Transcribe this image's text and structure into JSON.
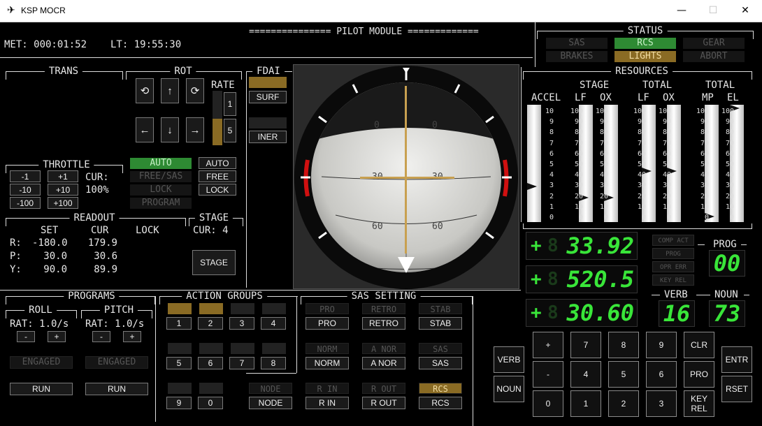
{
  "window": {
    "title": "KSP MOCR",
    "app_icon": "satellite-icon"
  },
  "header": {
    "met": "MET: 000:01:52",
    "lt": "LT: 19:55:30",
    "module_title": "=============== PILOT MODULE ============="
  },
  "status": {
    "title": "STATUS",
    "indicators": [
      {
        "label": "SAS",
        "state": "off"
      },
      {
        "label": "RCS",
        "state": "on"
      },
      {
        "label": "GEAR",
        "state": "off"
      },
      {
        "label": "BRAKES",
        "state": "off"
      },
      {
        "label": "LIGHTS",
        "state": "amber"
      },
      {
        "label": "ABORT",
        "state": "off"
      }
    ]
  },
  "trans": {
    "title": "TRANS"
  },
  "rot": {
    "title": "ROT",
    "rate_label": "RATE",
    "rate_values": [
      "1",
      "5"
    ],
    "buttons": [
      "⟲",
      "↑",
      "⟳",
      "←",
      "↓",
      "→"
    ]
  },
  "fdai": {
    "title": "FDAI",
    "modes": [
      "SURF",
      "INER"
    ]
  },
  "throttle": {
    "title": "THROTTLE",
    "buttons": [
      "-1",
      "+1",
      "-10",
      "+10",
      "-100",
      "+100"
    ],
    "cur_label": "CUR:",
    "cur_value": "100%"
  },
  "modes": {
    "indicators": [
      "AUTO",
      "FREE/SAS",
      "LOCK",
      "PROGRAM"
    ],
    "buttons": [
      "AUTO",
      "FREE",
      "LOCK"
    ]
  },
  "readout": {
    "title": "READOUT",
    "headers": [
      "SET",
      "CUR",
      "LOCK"
    ],
    "rows": [
      {
        "axis": "R:",
        "set": "-180.0",
        "cur": "179.9"
      },
      {
        "axis": "P:",
        "set": "30.0",
        "cur": "30.6"
      },
      {
        "axis": "Y:",
        "set": "90.0",
        "cur": "89.9"
      }
    ]
  },
  "stage": {
    "title": "STAGE",
    "cur": "CUR:  4",
    "button": "STAGE"
  },
  "resources": {
    "title": "RESOURCES",
    "group_labels": [
      "STAGE",
      "TOTAL",
      "TOTAL"
    ],
    "col_labels": [
      "ACCEL",
      "LF",
      "OX",
      "LF",
      "OX",
      "MP",
      "EL"
    ],
    "accel_scale": [
      "10",
      "9",
      "8",
      "7",
      "6",
      "5",
      "4",
      "3",
      "2",
      "1",
      "0"
    ],
    "pct_scale": [
      "100",
      "90",
      "80",
      "70",
      "60",
      "50",
      "40",
      "30",
      "20",
      "10",
      "0"
    ],
    "levels": {
      "accel": 0.3,
      "stage_lf": 0.2,
      "stage_ox": 0.2,
      "total_lf": 0.44,
      "total_ox": 0.44,
      "mp": 0.03,
      "el": 1.0
    }
  },
  "dsky": {
    "sign": "+",
    "r1": "33.92",
    "r2": "520.5",
    "r3": "30.60",
    "prog_label": "PROG",
    "prog": "00",
    "verb_label": "VERB",
    "verb": "16",
    "noun_label": "NOUN",
    "noun": "73",
    "lights": [
      "COMP ACT",
      "PROG",
      "OPR ERR",
      "KEY REL"
    ],
    "keys": [
      "+",
      "7",
      "8",
      "9",
      "CLR",
      "-",
      "4",
      "5",
      "6",
      "PRO",
      "0",
      "1",
      "2",
      "3",
      "KEY REL"
    ],
    "side_left": [
      "VERB",
      "NOUN"
    ],
    "side_right": [
      "ENTR",
      "RSET"
    ]
  },
  "programs": {
    "title": "PROGRAMS",
    "roll": {
      "title": "ROLL",
      "rat": "RAT: 1.0/s",
      "engaged": "ENGAGED",
      "run": "RUN"
    },
    "pitch": {
      "title": "PITCH",
      "rat": "RAT: 1.0/s",
      "engaged": "ENGAGED",
      "run": "RUN"
    },
    "minus": "-",
    "plus": "+"
  },
  "action_groups": {
    "title": "ACTION GROUPS",
    "groups": [
      {
        "label": "1",
        "active": true
      },
      {
        "label": "2",
        "active": true
      },
      {
        "label": "3",
        "active": false
      },
      {
        "label": "4",
        "active": false
      },
      {
        "label": "5",
        "active": false
      },
      {
        "label": "6",
        "active": false
      },
      {
        "label": "7",
        "active": false
      },
      {
        "label": "8",
        "active": false
      },
      {
        "label": "9",
        "active": false
      },
      {
        "label": "0",
        "active": false
      }
    ]
  },
  "sas_setting": {
    "title": "SAS SETTING",
    "modes": [
      {
        "ind": "PRO",
        "btn": "PRO",
        "state": "off"
      },
      {
        "ind": "RETRO",
        "btn": "RETRO",
        "state": "off"
      },
      {
        "ind": "STAB",
        "btn": "STAB",
        "state": "off"
      },
      {
        "ind": "NORM",
        "btn": "NORM",
        "state": "off"
      },
      {
        "ind": "A NOR",
        "btn": "A NOR",
        "state": "off"
      },
      {
        "ind": "SAS",
        "btn": "SAS",
        "state": "off"
      },
      {
        "ind": "NODE",
        "btn": "NODE",
        "state": "off"
      },
      {
        "ind": "R IN",
        "btn": "R IN",
        "state": "off"
      },
      {
        "ind": "R OUT",
        "btn": "R OUT",
        "state": "off"
      },
      {
        "ind": "RCS",
        "btn": "RCS",
        "state": "amber"
      }
    ]
  },
  "colors": {
    "on_green": "#2e8a33",
    "amber": "#8a6b24",
    "dsky_green": "#39e639",
    "horizon_red": "#d01010",
    "fdai_cross": "#c8a050"
  }
}
